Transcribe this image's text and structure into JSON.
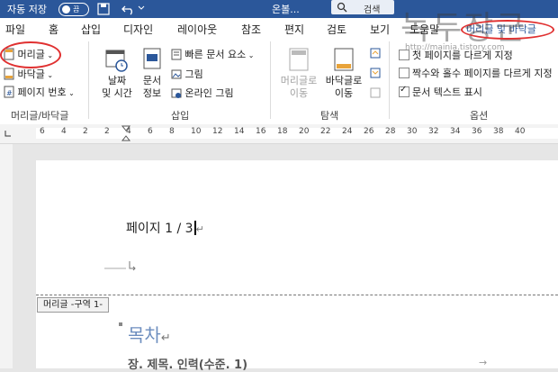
{
  "titlebar": {
    "autosave": "자동 저장",
    "autosave_state": "끔",
    "doc_name": "온볼...",
    "search": "검색"
  },
  "tabs": [
    "파일",
    "홈",
    "삽입",
    "디자인",
    "레이아웃",
    "참조",
    "편지",
    "검토",
    "보기",
    "도움말",
    "머리글 및 바닥글"
  ],
  "ribbon": {
    "header": "머리글",
    "footer": "바닥글",
    "page_number": "페이지 번호",
    "group_header_footer": "머리글/바닥글",
    "date_time_1": "날짜",
    "date_time_2": "및 시간",
    "doc_info_1": "문서",
    "doc_info_2": "정보",
    "quick_parts": "빠른 문서 요소",
    "picture": "그림",
    "online_picture": "온라인 그림",
    "group_insert": "삽입",
    "goto_header_1": "머리글로",
    "goto_header_2": "이동",
    "goto_footer_1": "바닥글로",
    "goto_footer_2": "이동",
    "group_navigation": "탐색",
    "opt_first_page": "첫 페이지를 다르게 지정",
    "opt_odd_even": "짝수와 홀수 페이지를 다르게 지정",
    "opt_show_text": "문서 텍스트 표시",
    "group_options": "옵션"
  },
  "ruler_numbers": [
    "6",
    "4",
    "2",
    "2",
    "4",
    "6",
    "8",
    "10",
    "12",
    "14",
    "16",
    "18",
    "20",
    "22",
    "24",
    "26",
    "28",
    "30",
    "32",
    "34",
    "36",
    "38",
    "40"
  ],
  "document": {
    "page_line": "페이지 1 / 3",
    "section_tag": "머리글 -구역 1-",
    "toc_heading": "목차",
    "chapter": "장. 제목. 인력(수준. 1)"
  },
  "watermark": {
    "title": "녹두장군",
    "site": "http://mainia.tistory.com"
  },
  "colors": {
    "accent": "#2b579a",
    "annotation": "#e03030",
    "toc": "#6d8ebf"
  }
}
